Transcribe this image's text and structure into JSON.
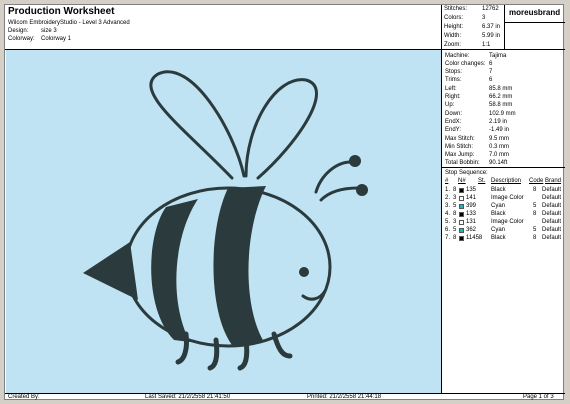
{
  "header": {
    "title": "Production Worksheet",
    "software": "Wilcom EmbroideryStudio - Level 3 Advanced",
    "design_label": "Design:",
    "design_value": "size 3",
    "colorway_label": "Colorway:",
    "colorway_value": "Colorway 1"
  },
  "stats": [
    {
      "label": "Stitches:",
      "value": "12762"
    },
    {
      "label": "Colors:",
      "value": "3"
    },
    {
      "label": "Height:",
      "value": "6.37 in"
    },
    {
      "label": "Width:",
      "value": "5.99 in"
    },
    {
      "label": "Zoom:",
      "value": "1:1"
    }
  ],
  "brand": "moreusbrand",
  "info": [
    {
      "label": "Machine:",
      "value": "Tajima"
    },
    {
      "label": "Color changes:",
      "value": "6"
    },
    {
      "label": "Stops:",
      "value": "7"
    },
    {
      "label": "Trims:",
      "value": "6"
    },
    {
      "label": "Left:",
      "value": "85.8 mm"
    },
    {
      "label": "Right:",
      "value": "66.2 mm"
    },
    {
      "label": "Up:",
      "value": "58.8 mm"
    },
    {
      "label": "Down:",
      "value": "102.9 mm"
    },
    {
      "label": "EndX:",
      "value": "2.19 in"
    },
    {
      "label": "EndY:",
      "value": "-1.49 in"
    },
    {
      "label": "Max Stitch:",
      "value": "9.5 mm"
    },
    {
      "label": "Min Stitch:",
      "value": "0.3 mm"
    },
    {
      "label": "Max Jump:",
      "value": "7.0 mm"
    },
    {
      "label": "Total Bobbin:",
      "value": "90.14ft"
    }
  ],
  "sequence": {
    "title": "Stop Sequence:",
    "headers": [
      "#",
      "N#",
      "St.",
      "Description",
      "Code",
      "Brand"
    ],
    "rows": [
      {
        "num": "1.",
        "n": "8",
        "color": "#000000",
        "st": "135",
        "desc": "Black",
        "code": "8",
        "brand": "Default"
      },
      {
        "num": "2.",
        "n": "3",
        "color": "#ffffff",
        "st": "141",
        "desc": "Image Color",
        "code": "",
        "brand": "Default"
      },
      {
        "num": "3.",
        "n": "5",
        "color": "#19b5c6",
        "st": "399",
        "desc": "Cyan",
        "code": "5",
        "brand": "Default"
      },
      {
        "num": "4.",
        "n": "8",
        "color": "#000000",
        "st": "133",
        "desc": "Black",
        "code": "8",
        "brand": "Default"
      },
      {
        "num": "5.",
        "n": "3",
        "color": "#ffffff",
        "st": "131",
        "desc": "Image Color",
        "code": "",
        "brand": "Default"
      },
      {
        "num": "6.",
        "n": "5",
        "color": "#19b5c6",
        "st": "362",
        "desc": "Cyan",
        "code": "5",
        "brand": "Default"
      },
      {
        "num": "7.",
        "n": "8",
        "color": "#000000",
        "st": "11458",
        "desc": "Black",
        "code": "8",
        "brand": "Default"
      }
    ]
  },
  "footer": {
    "created": "Created By:",
    "last_saved": "Last Saved: 21/2/2558 21:41:50",
    "printed": "Printed: 21/2/2558 21:44:18",
    "page": "Page 1 of 3"
  },
  "colors": {
    "canvas_bg": "#bfe3f3",
    "stitch": "#2b3a3c"
  }
}
